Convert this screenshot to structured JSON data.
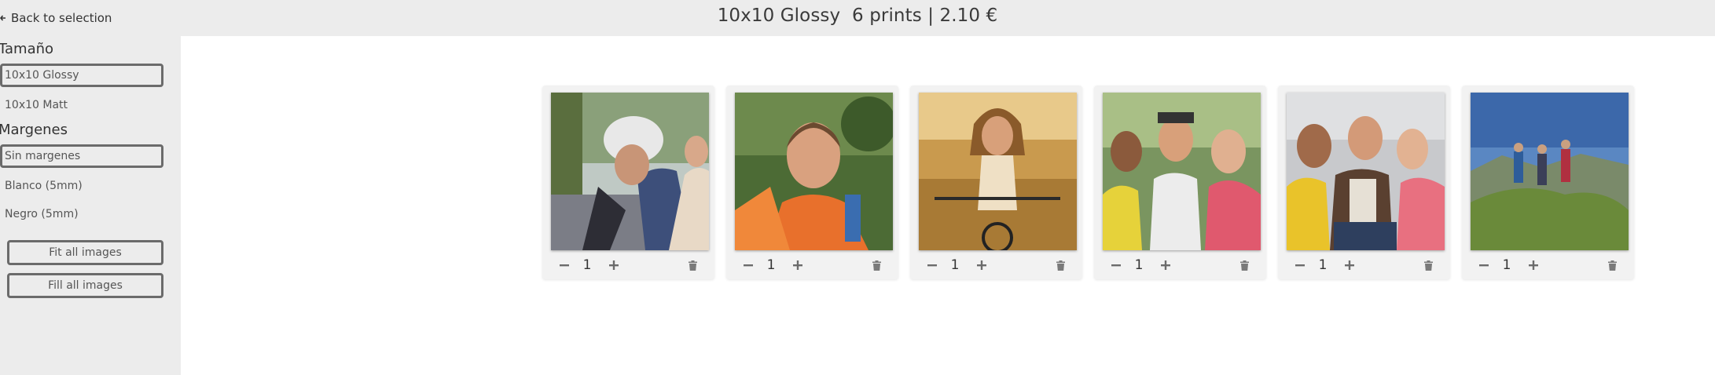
{
  "header": {
    "back_label": "Back to selection",
    "title_product": "10x10 Glossy",
    "title_prints": "6 prints",
    "title_separator": "|",
    "title_price": "2.10 €"
  },
  "sidebar": {
    "size_section": {
      "title": "Tamaño",
      "options": [
        "10x10 Glossy",
        "10x10 Matt"
      ],
      "selected": "10x10 Glossy"
    },
    "margin_section": {
      "title": "Margenes",
      "options": [
        "Sin margenes",
        "Blanco (5mm)",
        "Negro (5mm)"
      ],
      "selected": "Sin margenes"
    },
    "fit_all_label": "Fit all images",
    "fill_all_label": "Fill all images"
  },
  "prints": [
    {
      "subject": "couple-on-scooter",
      "quantity": "1"
    },
    {
      "subject": "hiker-selfie",
      "quantity": "1"
    },
    {
      "subject": "woman-on-bicycle",
      "quantity": "1"
    },
    {
      "subject": "friends-group-selfie",
      "quantity": "1"
    },
    {
      "subject": "three-friends-smiling",
      "quantity": "1"
    },
    {
      "subject": "hikers-on-mountain",
      "quantity": "1"
    }
  ],
  "colors": {
    "topbar_bg": "#ececec",
    "sidebar_bg": "#ececec",
    "card_bg": "#f2f2f2",
    "border": "#6b6b6b",
    "icon": "#6b6b6b"
  }
}
